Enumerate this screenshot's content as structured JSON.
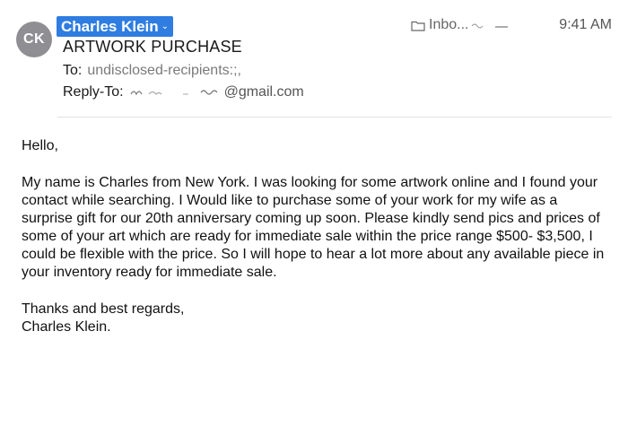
{
  "header": {
    "avatar_initials": "CK",
    "sender_name": "Charles Klein",
    "mailbox_label": "Inbo...",
    "time": "9:41 AM",
    "subject": "ARTWORK PURCHASE",
    "to_label": "To:",
    "to_value": "undisclosed-recipients:;,",
    "reply_to_label": "Reply-To:",
    "reply_to_domain": "@gmail.com",
    "icons": {
      "mailbox": "folder-icon",
      "sender_menu": "chevron-down-icon"
    },
    "colors": {
      "sender_highlight": "#2f7de1",
      "avatar_bg": "#8e8e93"
    }
  },
  "message": {
    "greeting": "Hello,",
    "paragraph": "My name is Charles from New York. I was looking for some artwork online and I found your contact while searching. I Would like to purchase some of your work for my wife as a surprise gift for our 20th anniversary coming up soon. Please kindly send pics and prices of some of your art which are ready for immediate sale within the price range $500- $3,500, I could be flexible with the price. So I will hope to hear a lot more about any available piece in your inventory ready for immediate sale.",
    "closing": "Thanks and best regards,",
    "signature": "Charles Klein."
  }
}
